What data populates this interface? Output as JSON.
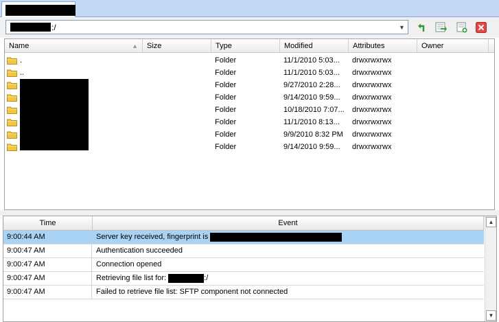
{
  "tab": {
    "label": ""
  },
  "path": {
    "suffix": ":/"
  },
  "file_list": {
    "columns": [
      "Name",
      "Size",
      "Type",
      "Modified",
      "Attributes",
      "Owner"
    ],
    "rows": [
      {
        "name": ".",
        "size": "",
        "type": "Folder",
        "modified": "11/1/2010  5:03...",
        "attributes": "drwxrwxrwx",
        "owner": ""
      },
      {
        "name": "..",
        "size": "",
        "type": "Folder",
        "modified": "11/1/2010  5:03...",
        "attributes": "drwxrwxrwx",
        "owner": ""
      },
      {
        "name": "",
        "size": "",
        "type": "Folder",
        "modified": "9/27/2010  2:28...",
        "attributes": "drwxrwxrwx",
        "owner": ""
      },
      {
        "name": "",
        "size": "",
        "type": "Folder",
        "modified": "9/14/2010  9:59...",
        "attributes": "drwxrwxrwx",
        "owner": ""
      },
      {
        "name": "",
        "size": "",
        "type": "Folder",
        "modified": "10/18/2010  7:07...",
        "attributes": "drwxrwxrwx",
        "owner": ""
      },
      {
        "name": "",
        "size": "",
        "type": "Folder",
        "modified": "11/1/2010  8:13...",
        "attributes": "drwxrwxrwx",
        "owner": ""
      },
      {
        "name": "",
        "size": "",
        "type": "Folder",
        "modified": "9/9/2010 8:32 PM",
        "attributes": "drwxrwxrwx",
        "owner": ""
      },
      {
        "name": "",
        "size": "",
        "type": "Folder",
        "modified": "9/14/2010  9:59...",
        "attributes": "drwxrwxrwx",
        "owner": ""
      }
    ]
  },
  "log": {
    "columns": [
      "Time",
      "Event"
    ],
    "rows": [
      {
        "time": "9:00:44 AM",
        "event": "Server key received, fingerprint is",
        "selected": true
      },
      {
        "time": "9:00:47 AM",
        "event": "Authentication succeeded",
        "selected": false
      },
      {
        "time": "9:00:47 AM",
        "event": "Connection opened",
        "selected": false
      },
      {
        "time": "9:00:47 AM",
        "event": "Retrieving file list for:",
        "event_suffix": ":/",
        "selected": false
      },
      {
        "time": "9:00:47 AM",
        "event": "Failed to retrieve file list: SFTP component not connected",
        "selected": false
      }
    ]
  },
  "colors": {
    "tab_strip": "#c3d9f5",
    "selection": "#a9d3f5",
    "folder": "#f3c544",
    "delete": "#e04848"
  },
  "icons": [
    "refresh-icon",
    "sync-icon",
    "new-tab-icon",
    "close-icon",
    "folder-icon",
    "chevron-down-icon"
  ]
}
